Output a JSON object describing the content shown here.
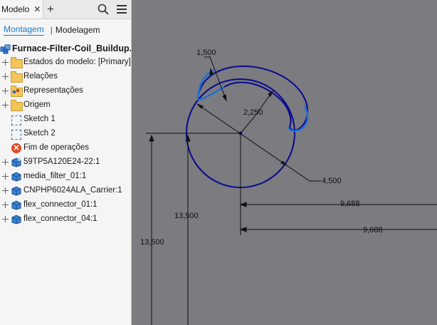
{
  "browser": {
    "tab_label": "Modelo",
    "tab_close": "✕",
    "tab_add": "+",
    "subtabs": [
      "Montagem",
      "Modelagem"
    ],
    "subtab_separator": "|",
    "root": "Furnace-Filter-Coil_Buildup.iam",
    "items": [
      {
        "label": "Estados do modelo: [Primary]",
        "icon": "folder-icon",
        "expandable": true
      },
      {
        "label": "Relações",
        "icon": "folder-icon",
        "expandable": true
      },
      {
        "label": "Representações",
        "icon": "representations-folder-icon",
        "expandable": true
      },
      {
        "label": "Origem",
        "icon": "folder-icon",
        "expandable": true
      },
      {
        "label": "Sketch 1",
        "icon": "sketch-icon",
        "expandable": false
      },
      {
        "label": "Sketch 2",
        "icon": "sketch-icon",
        "expandable": false
      },
      {
        "label": "Fim de operações",
        "icon": "end-of-features-icon",
        "expandable": false
      },
      {
        "label": "59TP5A120E24-22:1",
        "icon": "component-icon",
        "expandable": true
      },
      {
        "label": "media_filter_01:1",
        "icon": "component-icon",
        "expandable": true
      },
      {
        "label": "CNPHP6024ALA_Carrier:1",
        "icon": "component-icon",
        "expandable": true
      },
      {
        "label": "flex_connector_01:1",
        "icon": "component-icon",
        "expandable": true
      },
      {
        "label": "flex_connector_04:1",
        "icon": "component-icon",
        "expandable": true
      }
    ]
  },
  "dimensions": {
    "d1": "1,500",
    "d2": "2,250",
    "d3": "4,500",
    "d4": "9,688",
    "d5": "9,688",
    "d6": "13,500",
    "d7": "13,500"
  },
  "colors": {
    "canvas": "#7b7b80",
    "circle": "#0a0a8f",
    "selected_curve": "#1f6fd6",
    "accent": "#1f7ac7"
  }
}
